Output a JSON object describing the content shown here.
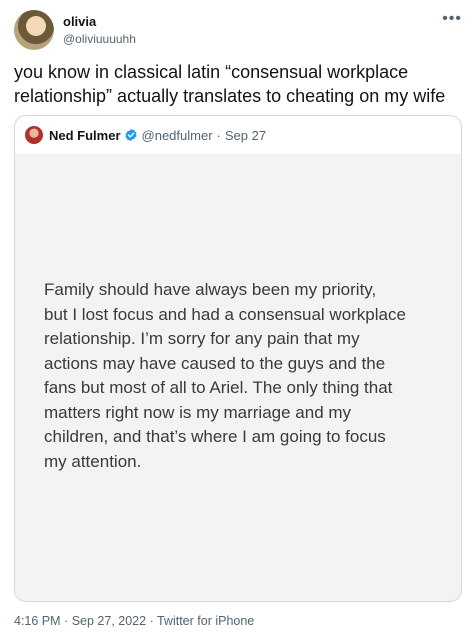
{
  "author": {
    "name": "olivia",
    "handle": "@oliviuuuuhh"
  },
  "tweet": {
    "text": "you know in classical latin “consensual workplace relationship” actually translates to cheating on my wife"
  },
  "quoted": {
    "name": "Ned Fulmer",
    "handle": "@nedfulmer",
    "separator": "·",
    "date": "Sep 27",
    "statement_lines": [
      "Family should have always been my priority,",
      "but I lost focus and had a consensual workplace",
      "relationship.  I’m sorry for any pain that my",
      "actions may have caused to the guys and the",
      "fans but most of all to Ariel. The only thing that",
      "matters right now is my marriage and my",
      "children, and that’s where I am going to focus",
      "my attention."
    ]
  },
  "footer": {
    "time": "4:16 PM",
    "separator": "·",
    "date": "Sep 27, 2022",
    "source": "Twitter for iPhone"
  },
  "icons": {
    "more": "more-icon",
    "verified": "verified-badge-icon",
    "verified_color": "#1d9bf0"
  }
}
